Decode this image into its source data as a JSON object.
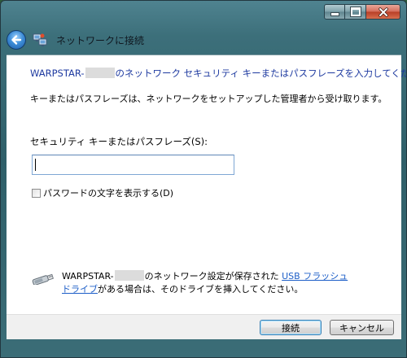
{
  "window": {
    "title": "ネットワークに接続"
  },
  "dialog": {
    "heading_prefix": "WARPSTAR-",
    "heading_suffix": "のネットワーク セキュリティ キーまたはパスフレーズを入力してください",
    "description": "キーまたはパスフレーズは、ネットワークをセットアップした管理者から受け取ります。",
    "key_label": "セキュリティ キーまたはパスフレーズ(S):",
    "key_value": "",
    "show_characters_label": "パスワードの文字を表示する(D)",
    "show_characters_checked": false,
    "usb_note_prefix": "WARPSTAR-",
    "usb_note_middle": "のネットワーク設定が保存された ",
    "usb_link": "USB フラッシュ ドライブ",
    "usb_note_suffix": "がある場合は、そのドライブを挿入してください。"
  },
  "buttons": {
    "connect": "接続",
    "cancel": "キャンセル"
  },
  "colors": {
    "heading": "#1e3aa0",
    "link": "#1e5fc8",
    "client_bg": "#ffffff",
    "button_bar_bg": "#f0f0f0"
  }
}
